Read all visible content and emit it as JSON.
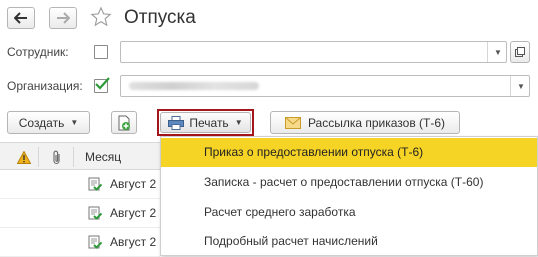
{
  "header": {
    "title": "Отпуска",
    "back_icon": "arrow-left-icon",
    "forward_icon": "arrow-right-icon",
    "favorite_icon": "star-icon"
  },
  "filters": {
    "employee_label": "Сотрудник:",
    "employee_checked": false,
    "employee_value": "",
    "organization_label": "Организация:",
    "organization_checked": true
  },
  "toolbar": {
    "create_label": "Создать",
    "add_icon": "add-document-icon",
    "print_label": "Печать",
    "print_icon": "printer-icon",
    "mailing_label": "Рассылка приказов (Т-6)",
    "mailing_icon": "envelope-icon"
  },
  "table": {
    "month_header": "Месяц",
    "rows": [
      {
        "month": "Август 2"
      },
      {
        "month": "Август 2"
      },
      {
        "month": "Август 2"
      }
    ]
  },
  "print_menu": {
    "items": [
      {
        "label": "Приказ о предоставлении отпуска (Т-6)"
      },
      {
        "label": "Записка - расчет о предоставлении отпуска (Т-60)"
      },
      {
        "label": "Расчет среднего заработка"
      },
      {
        "label": "Подробный расчет начислений"
      }
    ]
  },
  "colors": {
    "highlight": "#f5d426",
    "print_border": "#a3161a",
    "checkmark": "#2e9b3a"
  }
}
